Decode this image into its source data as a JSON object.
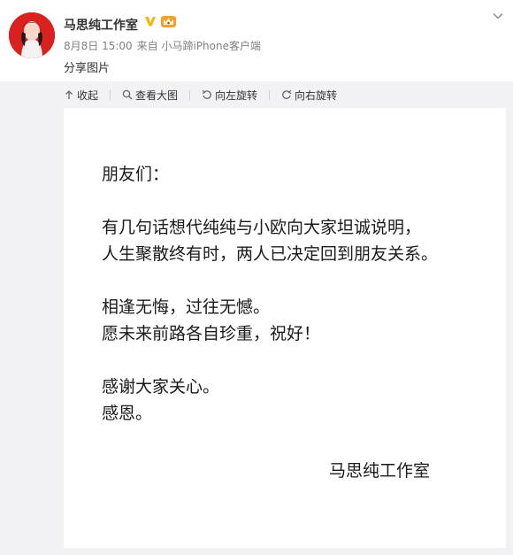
{
  "post": {
    "author_name": "马思纯工作室",
    "date": "8月8日 15:00",
    "source": "来自 小马蹄iPhone客户端",
    "text": "分享图片"
  },
  "toolbar": {
    "collapse": "收起",
    "view_large": "查看大图",
    "rotate_left": "向左旋转",
    "rotate_right": "向右旋转"
  },
  "image": {
    "greeting": "朋友们：",
    "paragraphs": [
      [
        "有几句话想代纯纯与小欧向大家坦诚说明，",
        "人生聚散终有时，两人已决定回到朋友关系。"
      ],
      [
        "相逢无悔，过往无憾。",
        "愿未来前路各自珍重，祝好！"
      ],
      [
        "感谢大家关心。",
        "感恩。"
      ]
    ],
    "signature": "马思纯工作室"
  },
  "colors": {
    "verified": "#f7b500",
    "media_bg": "#f2f2f5",
    "avatar": "#d9221f"
  }
}
